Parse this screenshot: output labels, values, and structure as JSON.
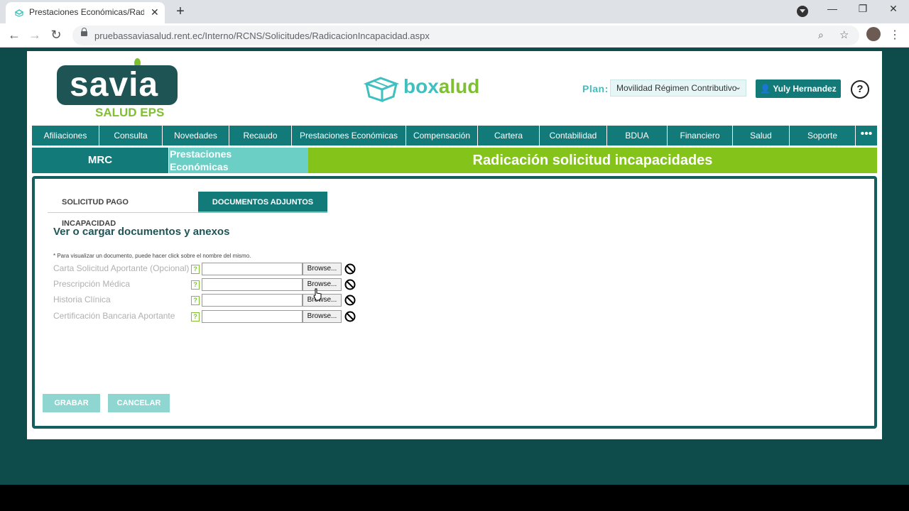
{
  "browser": {
    "tab_title": "Prestaciones Económicas/Radicac",
    "url": "pruebassaviasalud.rent.ec/Interno/RCNS/Solicitudes/RadicacionIncapacidad.aspx"
  },
  "header": {
    "logo_word": "savia",
    "logo_sub": "SALUD EPS",
    "brand_box": "box",
    "brand_alud": "alud",
    "plan_label": "Plan:",
    "plan_value": "Movilidad Régimen Contributivo",
    "user_name": "Yuly Hernandez",
    "help": "?"
  },
  "nav": {
    "items": [
      {
        "label": "Afiliaciones"
      },
      {
        "label": "Consulta"
      },
      {
        "label": "Novedades"
      },
      {
        "label": "Recaudo"
      },
      {
        "label": "Prestaciones Económicas"
      },
      {
        "label": "Compensación"
      },
      {
        "label": "Cartera"
      },
      {
        "label": "Contabilidad"
      },
      {
        "label": "BDUA"
      },
      {
        "label": "Financiero"
      },
      {
        "label": "Salud"
      },
      {
        "label": "Soporte"
      }
    ],
    "more": "•••"
  },
  "breadcrumb": {
    "root": "MRC",
    "section_line1": "Prestaciones",
    "section_line2": "Económicas",
    "page": "Radicación solicitud incapacidades"
  },
  "tabs": {
    "tab1": "SOLICITUD PAGO INCAPACIDAD",
    "tab2": "DOCUMENTOS ADJUNTOS",
    "active": "DOCUMENTOS ADJUNTOS"
  },
  "documents": {
    "title": "Ver o cargar documentos y anexos",
    "note": "* Para visualizar un documento, puede hacer click sobre el nombre del mismo.",
    "rows": [
      {
        "label": "Carta Solicitud Aportante (Opcional)",
        "browse": "Browse..."
      },
      {
        "label": "Prescripción Médica",
        "browse": "Browse..."
      },
      {
        "label": "Historia Clínica",
        "browse": "Browse..."
      },
      {
        "label": "Certificación Bancaria Aportante",
        "browse": "Browse..."
      }
    ],
    "help_mark": "?"
  },
  "actions": {
    "save": "GRABAR",
    "cancel": "CANCELAR"
  },
  "colors": {
    "teal_dark": "#137a7a",
    "teal_light": "#6ccfc6",
    "green": "#84c41a",
    "frame": "#0e4b4b"
  }
}
